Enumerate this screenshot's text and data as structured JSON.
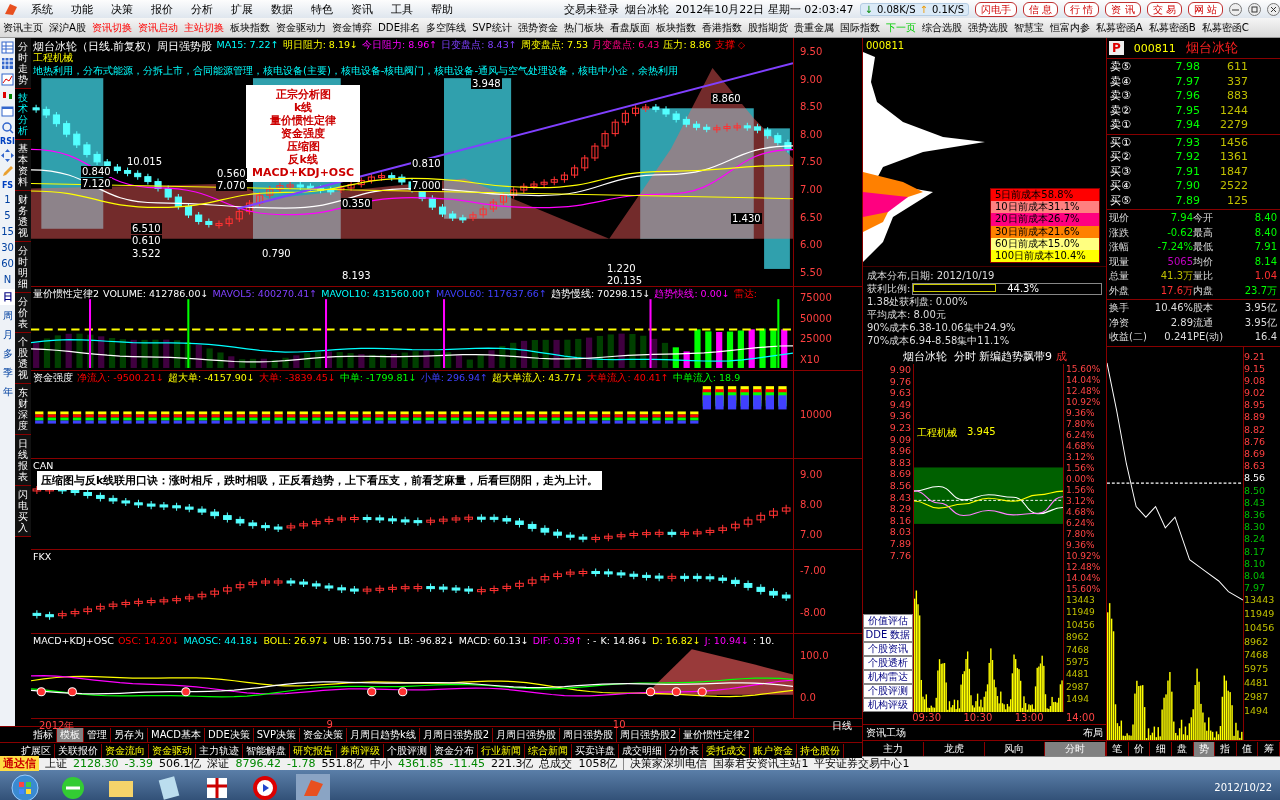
{
  "title_bar": {
    "menu": [
      "系统",
      "功能",
      "决策",
      "报价",
      "分析",
      "扩展",
      "数据",
      "特色",
      "资讯",
      "工具",
      "帮助"
    ],
    "login_status": "交易未登录",
    "stock": "烟台冰轮",
    "datetime": "2012年10月22日 星期一 02:03:47",
    "download_arrow": "↓",
    "download_rate": "0.08K/S",
    "upload_arrow": "↑",
    "upload_rate": "0.1K/S",
    "buttons": [
      "闪电手",
      "信 息",
      "行 情",
      "资 讯",
      "交 易",
      "网 站"
    ]
  },
  "toolbar": [
    {
      "label": "资讯主页",
      "kind": "normal"
    },
    {
      "label": "深沪A股",
      "kind": "normal"
    },
    {
      "label": "资讯切换",
      "kind": "alert"
    },
    {
      "label": "资讯启动",
      "kind": "alert"
    },
    {
      "label": "主站切换",
      "kind": "alert"
    },
    {
      "label": "板块指数",
      "kind": "normal"
    },
    {
      "label": "资金驱动力",
      "kind": "normal"
    },
    {
      "label": "资金博弈",
      "kind": "normal"
    },
    {
      "label": "DDE排名",
      "kind": "normal"
    },
    {
      "label": "多空阵线",
      "kind": "normal"
    },
    {
      "label": "SVP统计",
      "kind": "normal"
    },
    {
      "label": "强势资金",
      "kind": "normal"
    },
    {
      "label": "热门板块",
      "kind": "normal"
    },
    {
      "label": "看盘版面",
      "kind": "normal"
    },
    {
      "label": "板块指数",
      "kind": "normal"
    },
    {
      "label": "香港指数",
      "kind": "normal"
    },
    {
      "label": "股指期货",
      "kind": "normal"
    },
    {
      "label": "贵重金属",
      "kind": "normal"
    },
    {
      "label": "国际指数",
      "kind": "normal"
    },
    {
      "label": "下一页",
      "kind": "next"
    },
    {
      "label": "综合选股",
      "kind": "normal"
    },
    {
      "label": "强势选股",
      "kind": "normal"
    },
    {
      "label": "智慧宝",
      "kind": "normal"
    },
    {
      "label": "恒富内参",
      "kind": "normal"
    },
    {
      "label": "私募密函A",
      "kind": "normal"
    },
    {
      "label": "私募密函B",
      "kind": "normal"
    },
    {
      "label": "私募密函C",
      "kind": "normal"
    }
  ],
  "tool_labels": [
    "RSI",
    "FS"
  ],
  "period_buttons": [
    {
      "label": "1",
      "selected": false
    },
    {
      "label": "5",
      "selected": false
    },
    {
      "label": "15",
      "selected": false
    },
    {
      "label": "30",
      "selected": false
    },
    {
      "label": "60",
      "selected": false
    },
    {
      "label": "N",
      "selected": false
    },
    {
      "label": "日",
      "selected": true
    },
    {
      "label": "周",
      "selected": false
    },
    {
      "label": "月",
      "selected": false
    },
    {
      "label": "多",
      "selected": false
    },
    {
      "label": "季",
      "selected": false
    },
    {
      "label": "年",
      "selected": false
    }
  ],
  "side_tabs": [
    {
      "label": "分时走势",
      "selected": false
    },
    {
      "label": "技术分析",
      "selected": true
    },
    {
      "label": "基本资料",
      "selected": false
    },
    {
      "label": "财务透视",
      "selected": false
    },
    {
      "label": "分时明细",
      "selected": false
    },
    {
      "label": "分价表",
      "selected": false
    },
    {
      "label": "个股透视",
      "selected": false
    },
    {
      "label": "东财深度",
      "selected": false
    },
    {
      "label": "日线报表",
      "selected": false
    },
    {
      "label": "闪电买入",
      "selected": false
    }
  ],
  "main_chart": {
    "title": "烟台冰轮（日线.前复权）周日强势股",
    "indicators": [
      "MA15: 7.22↑",
      "明日阻力: 8.19↓",
      "今日阻力: 8.96↑",
      "日变盘点: 8.43↑",
      "周变盘点: 7.53",
      "月变盘点: 6.43",
      "压力: 8.86",
      "支撑 ◇"
    ],
    "sector": "工程机械",
    "concepts": "地热利用，分布式能源，分拆上市，合同能源管理，核电设备(主要)，核电设备-核电阀门，核电设备-通风与空气处理设备，核电中小企，余热利用",
    "legend_lines": [
      "正宗分析图",
      "k线",
      "量价惯性定律",
      "资金强度",
      "压缩图",
      "反k线",
      "MACD+KDJ+OSC"
    ],
    "price_axis": [
      "9.50",
      "9.00",
      "8.50",
      "8.00",
      "7.50",
      "7.00",
      "6.50",
      "6.00",
      "5.50"
    ],
    "annotations": [
      "0.840",
      "7.120",
      "10.015",
      "0.560",
      "7.070",
      "0.810",
      "7.000",
      "0.350",
      "6.510",
      "0.610",
      "3.522",
      "0.790",
      "8.193",
      "1.220",
      "20.135",
      "1.430",
      "8.860",
      "3.948"
    ]
  },
  "volume_panel": {
    "indicators": [
      "量价惯性定律2",
      "VOLUME: 412786.00↓",
      "MAVOL5: 400270.41↑",
      "MAVOL10: 431560.00↑",
      "MAVOL60: 117637.66↑",
      "趋势慢线: 70298.15↓",
      "趋势快线: 0.00↓",
      "雷达:"
    ],
    "axis": [
      "75000",
      "50000",
      "25000"
    ],
    "multiplier": "X10"
  },
  "fund_panel": {
    "title": "资金强度",
    "indicators": [
      "净流入: -9500.21↓",
      "超大单: -4157.90↓",
      "大单: -3839.45↓",
      "中单: -1799.81↓",
      "小单: 296.94↑",
      "超大单流入: 43.77↓",
      "大单流入: 40.41↑",
      "中单流入: 18.9"
    ],
    "axis": [
      "10000"
    ]
  },
  "can_panel": {
    "title": "CAN",
    "banner": "压缩图与反k线联用口诀：涨时相斥，跌时相吸，正反看趋势，上下看压支，前看芝麻量，后看巨阴阳，走为上计。",
    "axis": [
      "9.00",
      "8.00",
      "7.00"
    ]
  },
  "fkx_panel": {
    "title": "FKX",
    "axis": [
      "-7.00",
      "-8.00"
    ]
  },
  "macd_panel": {
    "indicators": [
      "MACD+KDJ+OSC",
      "OSC: 14.20↓",
      "MAOSC: 44.18↓",
      "BOLL: 26.97↓",
      "UB: 150.75↓",
      "LB: -96.82↓",
      "MACD: 60.13↓",
      "DIF: 0.39↑",
      ": -",
      "K: 14.86↓",
      "D: 16.82↓",
      "J: 10.94↓",
      ": 10."
    ],
    "axis": [
      "100.0",
      "0.0"
    ]
  },
  "date_axis": {
    "labels": [
      "2012年",
      "9",
      "10"
    ],
    "period": "日线"
  },
  "template_tabs": [
    {
      "label": "指标",
      "selected": false
    },
    {
      "label": "模板",
      "selected": true
    },
    {
      "label": "管理",
      "selected": false
    },
    {
      "label": "另存为",
      "selected": false
    },
    {
      "label": "MACD基本",
      "selected": false
    },
    {
      "label": "DDE决策",
      "selected": false
    },
    {
      "label": "SVP决策",
      "selected": false
    },
    {
      "label": "资金决策",
      "selected": false
    },
    {
      "label": "月周日趋势k线",
      "selected": false
    },
    {
      "label": "月周日强势股2",
      "selected": false
    },
    {
      "label": "月周日强势股",
      "selected": false
    },
    {
      "label": "周日强势股",
      "selected": false
    },
    {
      "label": "周日强势股2",
      "selected": false
    },
    {
      "label": "量价惯性定律2",
      "selected": false
    }
  ],
  "extension_tabs": [
    {
      "label": "扩展区",
      "kind": "plain"
    },
    {
      "label": "关联报价",
      "kind": "plain"
    },
    {
      "label": "资金流向",
      "kind": "featured"
    },
    {
      "label": "资金驱动",
      "kind": "featured"
    },
    {
      "label": "主力轨迹",
      "kind": "plain"
    },
    {
      "label": "智能解盘",
      "kind": "plain"
    },
    {
      "label": "研究报告",
      "kind": "featured"
    },
    {
      "label": "券商评级",
      "kind": "featured"
    },
    {
      "label": "个股评测",
      "kind": "plain"
    },
    {
      "label": "资金分布",
      "kind": "plain"
    },
    {
      "label": "行业新闻",
      "kind": "featured"
    },
    {
      "label": "综合新闻",
      "kind": "featured"
    },
    {
      "label": "买卖详盘",
      "kind": "plain"
    },
    {
      "label": "成交明细",
      "kind": "plain"
    },
    {
      "label": "分价表",
      "kind": "plain"
    },
    {
      "label": "委托成交",
      "kind": "featured"
    },
    {
      "label": "账户资金",
      "kind": "featured"
    },
    {
      "label": "持仓股份",
      "kind": "featured"
    }
  ],
  "chip_panel": {
    "code": "000811",
    "legend": [
      {
        "label": "5日前成本58.8%",
        "color": "#ff0000"
      },
      {
        "label": "10日前成本31.1%",
        "color": "#ff8080"
      },
      {
        "label": "20日前成本26.7%",
        "color": "#ff0080"
      },
      {
        "label": "30日前成本21.6%",
        "color": "#ff8000"
      },
      {
        "label": "60日前成本15.0%",
        "color": "#ffff80"
      },
      {
        "label": "100日前成本10.4%",
        "color": "#ffff00"
      }
    ],
    "date_line": "成本分布,日期: 2012/10/19",
    "profit_ratio": {
      "label": "获利比例:",
      "level": 0.443,
      "text": "44.3%"
    },
    "stats": [
      "1.38处获利盘: 0.00%",
      "平均成本: 8.00元",
      "90%成本6.38-10.06集中24.9%",
      "70%成本6.94-8.58集中11.1%"
    ]
  },
  "intraday": {
    "title": "烟台冰轮",
    "mode": "分时",
    "indicator": "新编趋势飘带9",
    "suffix": "成",
    "sector": "工程机械",
    "sector_value": "3.945",
    "price_axis": [
      "9.90",
      "9.76",
      "9.63",
      "9.49",
      "9.36",
      "9.23",
      "9.09",
      "8.96",
      "8.83",
      "8.69",
      "8.56",
      "8.43",
      "8.29",
      "8.16",
      "8.03",
      "7.89",
      "7.76"
    ],
    "pct_axis": [
      "15.60%",
      "14.04%",
      "12.48%",
      "10.92%",
      "9.36%",
      "7.80%",
      "6.24%",
      "4.68%",
      "3.12%",
      "1.56%",
      "0.00%",
      "1.56%",
      "3.12%",
      "4.68%",
      "6.24%",
      "7.80%",
      "9.36%",
      "10.92%",
      "12.48%",
      "14.04%",
      "15.60%"
    ],
    "volume_axis": [
      "13443",
      "11949",
      "10456",
      "8962",
      "7468",
      "5975",
      "4481",
      "2987",
      "1494"
    ],
    "times": [
      "09:30",
      "10:30",
      "13:00",
      "14:00"
    ],
    "side_buttons": [
      "价值评估",
      "DDE 数据",
      "个股资讯",
      "个股透析",
      "机构雷达",
      "个股评测",
      "机构评级"
    ],
    "tabs": [
      {
        "label": "主力",
        "selected": false
      },
      {
        "label": "龙虎",
        "selected": false
      },
      {
        "label": "风向",
        "selected": false
      },
      {
        "label": "分时",
        "selected": true
      }
    ],
    "left_corner": "资讯工场",
    "right_corner": "布局"
  },
  "quote": {
    "flag": "P",
    "code": "000811",
    "name": "烟台冰轮",
    "asks": [
      {
        "label": "卖⑤",
        "price": "7.98",
        "volume": "611"
      },
      {
        "label": "卖④",
        "price": "7.97",
        "volume": "337"
      },
      {
        "label": "卖③",
        "price": "7.96",
        "volume": "883"
      },
      {
        "label": "卖②",
        "price": "7.95",
        "volume": "1244"
      },
      {
        "label": "卖①",
        "price": "7.94",
        "volume": "2279"
      }
    ],
    "bids": [
      {
        "label": "买①",
        "price": "7.93",
        "volume": "1456"
      },
      {
        "label": "买②",
        "price": "7.92",
        "volume": "1361"
      },
      {
        "label": "买③",
        "price": "7.91",
        "volume": "1847"
      },
      {
        "label": "买④",
        "price": "7.90",
        "volume": "2522"
      },
      {
        "label": "买⑤",
        "price": "7.89",
        "volume": "125"
      }
    ],
    "stats": [
      {
        "label": "现价",
        "value": "7.94",
        "kind": "down"
      },
      {
        "label": "今开",
        "value": "8.40",
        "kind": "down"
      },
      {
        "label": "涨跌",
        "value": "-0.62",
        "kind": "down"
      },
      {
        "label": "最高",
        "value": "8.40",
        "kind": "down"
      },
      {
        "label": "涨幅",
        "value": "-7.24%",
        "kind": "down"
      },
      {
        "label": "最低",
        "value": "7.91",
        "kind": "down"
      },
      {
        "label": "现量",
        "value": "5065",
        "kind": "tick"
      },
      {
        "label": "均价",
        "value": "8.14",
        "kind": "down"
      },
      {
        "label": "总量",
        "value": "41.3万",
        "kind": "volume"
      },
      {
        "label": "量比",
        "value": "1.04",
        "kind": "up"
      },
      {
        "label": "外盘",
        "value": "17.6万",
        "kind": "up"
      },
      {
        "label": "内盘",
        "value": "23.7万",
        "kind": "down"
      }
    ],
    "capital": [
      {
        "label": "换手",
        "value": "10.46%"
      },
      {
        "label": "股本",
        "value": "3.95亿"
      },
      {
        "label": "净资",
        "value": "2.89"
      },
      {
        "label": "流通",
        "value": "3.95亿"
      },
      {
        "label": "收益(二)",
        "value": "0.241"
      },
      {
        "label": "PE(动)",
        "value": "16.4"
      }
    ],
    "price_axis": [
      {
        "label": "9.21",
        "kind": "up"
      },
      {
        "label": "9.15",
        "kind": "up"
      },
      {
        "label": "9.08",
        "kind": "up"
      },
      {
        "label": "9.02",
        "kind": "up"
      },
      {
        "label": "8.95",
        "kind": "up"
      },
      {
        "label": "8.89",
        "kind": "up"
      },
      {
        "label": "8.82",
        "kind": "up"
      },
      {
        "label": "8.76",
        "kind": "up"
      },
      {
        "label": "8.69",
        "kind": "up"
      },
      {
        "label": "8.63",
        "kind": "up"
      },
      {
        "label": "8.56",
        "kind": "base"
      },
      {
        "label": "8.50",
        "kind": "down"
      },
      {
        "label": "8.43",
        "kind": "down"
      },
      {
        "label": "8.36",
        "kind": "down"
      },
      {
        "label": "8.30",
        "kind": "down"
      },
      {
        "label": "8.24",
        "kind": "down"
      },
      {
        "label": "8.17",
        "kind": "down"
      },
      {
        "label": "8.10",
        "kind": "down"
      },
      {
        "label": "8.04",
        "kind": "down"
      },
      {
        "label": "7.97",
        "kind": "down"
      }
    ],
    "volume_axis": [
      "13443",
      "11949",
      "10456",
      "8962",
      "7468",
      "5975",
      "4481",
      "2987",
      "1494"
    ],
    "tabs": [
      {
        "label": "笔",
        "selected": false
      },
      {
        "label": "价",
        "selected": false
      },
      {
        "label": "细",
        "selected": false
      },
      {
        "label": "盘",
        "selected": false
      },
      {
        "label": "势",
        "selected": true
      },
      {
        "label": "指",
        "selected": false
      },
      {
        "label": "值",
        "selected": false
      },
      {
        "label": "筹",
        "selected": false
      }
    ]
  },
  "status_bar": {
    "brand": "通达信",
    "indices": [
      {
        "name": "上证",
        "value": "2128.30",
        "change": "-3.39",
        "amount": "506.1亿"
      },
      {
        "name": "深证",
        "value": "8796.42",
        "change": "-1.78",
        "amount": "551.8亿"
      },
      {
        "name": "中小",
        "value": "4361.85",
        "change": "-11.45",
        "amount": "221.3亿"
      }
    ],
    "total_label": "总成交",
    "total": "1058亿",
    "servers": [
      "决策家深圳电信",
      "国泰君安资讯主站1",
      "平安证券交易中心1"
    ]
  },
  "taskbar": {
    "date": "2012/10/22"
  }
}
